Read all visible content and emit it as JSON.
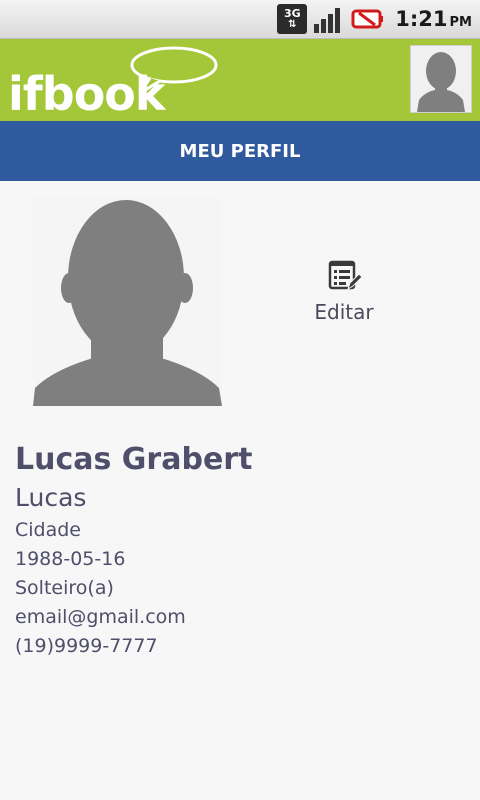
{
  "statusbar": {
    "network": "3G",
    "time": "1:21",
    "ampm": "PM"
  },
  "header": {
    "logo_text": "ifbook"
  },
  "title": "MEU PERFIL",
  "edit": {
    "label": "Editar"
  },
  "profile": {
    "name": "Lucas Grabert",
    "nickname": "Lucas",
    "city": "Cidade",
    "birthdate": "1988-05-16",
    "relationship": "Solteiro(a)",
    "email": "email@gmail.com",
    "phone": "(19)9999-7777"
  },
  "colors": {
    "header_green": "#a4c639",
    "title_blue": "#2f5a9e",
    "text": "#4f4f6b",
    "silhouette": "#7f7f7f"
  }
}
